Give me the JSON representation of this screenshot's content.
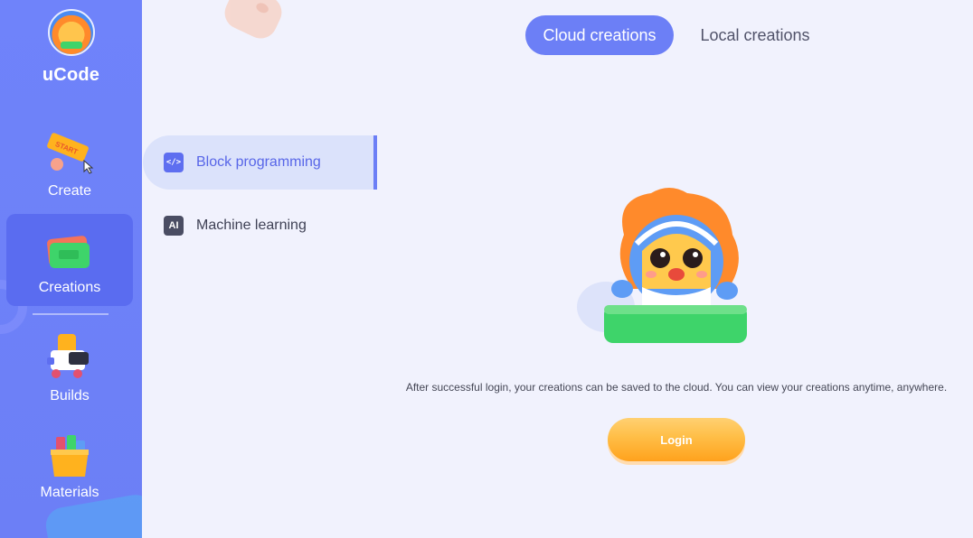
{
  "app": {
    "name": "uCode"
  },
  "sidebar": {
    "items": [
      {
        "label": "Create",
        "icon": "start-sign-icon"
      },
      {
        "label": "Creations",
        "icon": "creations-folder-icon"
      },
      {
        "label": "Builds",
        "icon": "robot-builds-icon"
      },
      {
        "label": "Materials",
        "icon": "materials-box-icon"
      }
    ],
    "active": "Creations",
    "create_badge": "START"
  },
  "tabs": [
    {
      "label": "Cloud creations",
      "active": true
    },
    {
      "label": "Local creations",
      "active": false
    }
  ],
  "submenu": [
    {
      "label": "Block programming",
      "icon": "code-icon",
      "active": true
    },
    {
      "label": "Machine learning",
      "icon": "ai-icon",
      "icon_text": "AI",
      "active": false
    }
  ],
  "main": {
    "message": "After successful login, your creations can be saved to the cloud. You can view your creations anytime, anywhere.",
    "login_label": "Login"
  },
  "colors": {
    "sidebar": "#6f83fa",
    "accent": "#6c7ff6",
    "background": "#f1f2fd",
    "login": "#ffa21d"
  }
}
